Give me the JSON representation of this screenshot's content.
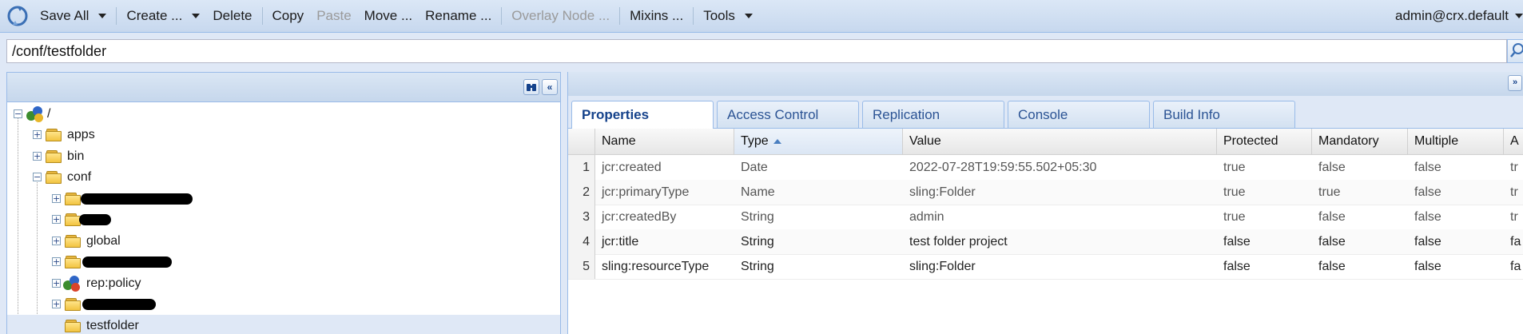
{
  "toolbar": {
    "save_all": "Save All",
    "create": "Create ...",
    "delete": "Delete",
    "copy": "Copy",
    "paste": "Paste",
    "move": "Move ...",
    "rename": "Rename ...",
    "overlay_node": "Overlay Node ...",
    "mixins": "Mixins ...",
    "tools": "Tools",
    "user": "admin@crx.default"
  },
  "path": {
    "value": "/conf/testfolder"
  },
  "tree": {
    "root": "/",
    "apps": "apps",
    "bin": "bin",
    "conf": "conf",
    "global": "global",
    "rep_policy": "rep:policy",
    "testfolder": "testfolder"
  },
  "tabs": [
    "Properties",
    "Access Control",
    "Replication",
    "Console",
    "Build Info"
  ],
  "grid": {
    "columns": [
      "Name",
      "Type",
      "Value",
      "Protected",
      "Mandatory",
      "Multiple",
      "A"
    ],
    "sorted_column": "Type",
    "rows": [
      {
        "num": "1",
        "name": "jcr:created",
        "type": "Date",
        "value": "2022-07-28T19:59:55.502+05:30",
        "protected": "true",
        "mandatory": "false",
        "multiple": "false",
        "extra": "tr"
      },
      {
        "num": "2",
        "name": "jcr:primaryType",
        "type": "Name",
        "value": "sling:Folder",
        "protected": "true",
        "mandatory": "true",
        "multiple": "false",
        "extra": "tr"
      },
      {
        "num": "3",
        "name": "jcr:createdBy",
        "type": "String",
        "value": "admin",
        "protected": "true",
        "mandatory": "false",
        "multiple": "false",
        "extra": "tr"
      },
      {
        "num": "4",
        "name": "jcr:title",
        "type": "String",
        "value": "test folder project",
        "protected": "false",
        "mandatory": "false",
        "multiple": "false",
        "extra": "fa"
      },
      {
        "num": "5",
        "name": "sling:resourceType",
        "type": "String",
        "value": "sling:Folder",
        "protected": "false",
        "mandatory": "false",
        "multiple": "false",
        "extra": "fa"
      }
    ]
  },
  "colors": {
    "accent": "#15428b",
    "panel_border": "#99bbe8",
    "selection": "#dfe8f6"
  }
}
